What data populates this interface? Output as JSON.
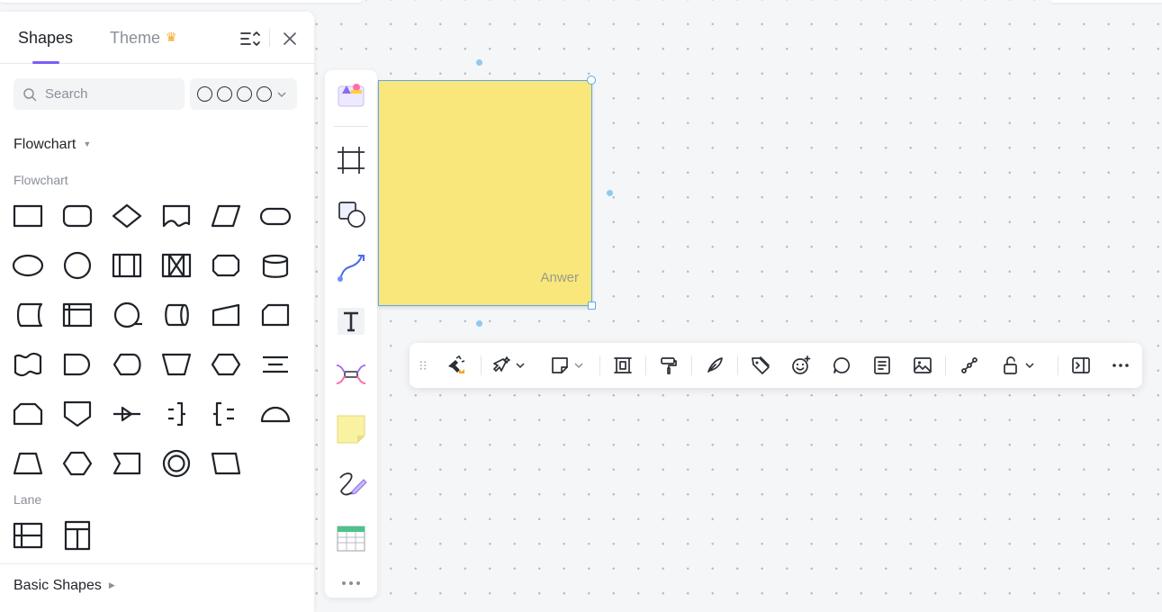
{
  "panel": {
    "tabs": [
      {
        "label": "Shapes",
        "active": true
      },
      {
        "label": "Theme",
        "badge_icon": "crown-icon",
        "premium": true
      }
    ],
    "header_icons": [
      "list-sort-icon",
      "close-icon"
    ],
    "search": {
      "placeholder": "Search",
      "value": ""
    },
    "style_selector": {
      "icon": "circle-style-icons",
      "circles": 4
    },
    "section": {
      "title": "Flowchart",
      "expanded": true
    },
    "groups": [
      {
        "label": "Flowchart",
        "shapes": [
          "process",
          "rounded-rectangle",
          "decision",
          "document",
          "data",
          "terminator",
          "ellipse",
          "circle",
          "predefined-process",
          "multiple-predefined",
          "preparation",
          "database",
          "stored-data",
          "internal-storage",
          "sequential-data",
          "direct-data",
          "manual-input",
          "card",
          "punched-tape",
          "delay",
          "display",
          "manual-operation",
          "hexagon",
          "annotation-lines",
          "loop-limit",
          "off-page-reference",
          "merge-arrow",
          "bracket-right",
          "bracket-left",
          "half-circle",
          "trapezoid",
          "octagon",
          "notched-shape",
          "double-circle",
          "skewed-box"
        ]
      },
      {
        "label": "Lane",
        "shapes": [
          "horizontal-lane",
          "vertical-lane"
        ]
      }
    ],
    "collapsed_section": {
      "title": "Basic Shapes",
      "expanded": false
    }
  },
  "vtoolbar": {
    "tools": [
      "templates-icon",
      "frame-icon",
      "shape-icon",
      "connector-icon",
      "text-icon",
      "mindmap-icon",
      "sticky-note-icon",
      "pen-icon",
      "table-icon",
      "more-icon"
    ]
  },
  "sticky": {
    "text": "Anwer",
    "color": "#f9e77c"
  },
  "htoolbar": {
    "tools": [
      "ai-magic-icon",
      "quick-style-icon",
      "sticky-shape-icon",
      "spacing-icon",
      "format-painter-icon",
      "pen-annotate-icon",
      "tag-icon",
      "emoji-icon",
      "comment-icon",
      "note-icon",
      "image-icon",
      "connect-icon",
      "lock-icon",
      "presenter-icon",
      "more-options-icon"
    ]
  },
  "colors": {
    "accent": "#7b5cf5",
    "selection": "#5aa9e6",
    "sticky": "#f9e77c",
    "canvas": "#f5f6f8"
  }
}
